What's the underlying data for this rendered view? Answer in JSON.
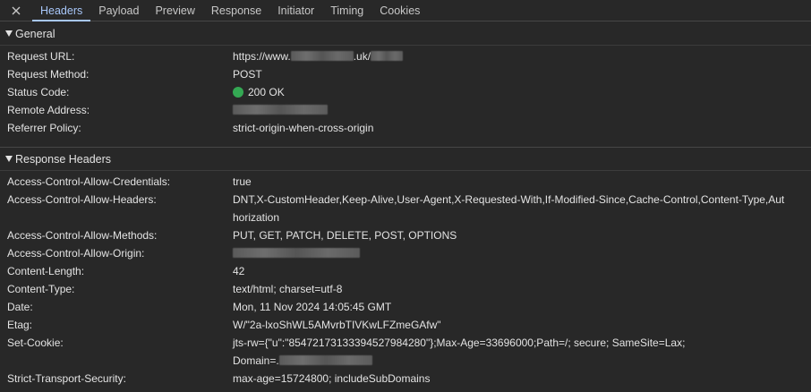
{
  "tabs": [
    {
      "label": "Headers",
      "active": true
    },
    {
      "label": "Payload"
    },
    {
      "label": "Preview"
    },
    {
      "label": "Response"
    },
    {
      "label": "Initiator"
    },
    {
      "label": "Timing"
    },
    {
      "label": "Cookies"
    }
  ],
  "general": {
    "title": "General",
    "rows": {
      "request_url": {
        "key": "Request URL:",
        "value_prefix": "https://www.",
        "value_mid": ".uk/"
      },
      "request_method": {
        "key": "Request Method:",
        "value": "POST"
      },
      "status_code": {
        "key": "Status Code:",
        "value": "200 OK",
        "status_color": "#34a853"
      },
      "remote_address": {
        "key": "Remote Address:"
      },
      "referrer_policy": {
        "key": "Referrer Policy:",
        "value": "strict-origin-when-cross-origin"
      }
    }
  },
  "response_headers": {
    "title": "Response Headers",
    "rows": {
      "acac": {
        "key": "Access-Control-Allow-Credentials:",
        "value": "true"
      },
      "acah": {
        "key": "Access-Control-Allow-Headers:",
        "value": "DNT,X-CustomHeader,Keep-Alive,User-Agent,X-Requested-With,If-Modified-Since,Cache-Control,Content-Type,Authorization"
      },
      "acam": {
        "key": "Access-Control-Allow-Methods:",
        "value": "PUT, GET, PATCH, DELETE, POST, OPTIONS"
      },
      "acao": {
        "key": "Access-Control-Allow-Origin:"
      },
      "content_length": {
        "key": "Content-Length:",
        "value": "42"
      },
      "content_type": {
        "key": "Content-Type:",
        "value": "text/html; charset=utf-8"
      },
      "date": {
        "key": "Date:",
        "value": "Mon, 11 Nov 2024 14:05:45 GMT"
      },
      "etag": {
        "key": "Etag:",
        "value": "W/\"2a-lxoShWL5AMvrbTIVKwLFZmeGAfw\""
      },
      "set_cookie": {
        "key": "Set-Cookie:",
        "value_line1": "jts-rw={\"u\":\"8547217313339452798428​0\"};Max-Age=33696000;Path=/; secure; SameSite=Lax;",
        "value_line2_prefix": "Domain=."
      },
      "sts": {
        "key": "Strict-Transport-Security:",
        "value": "max-age=15724800; includeSubDomains"
      }
    }
  },
  "colors": {
    "background": "#282828",
    "active_tab": "#a8c7fa",
    "text": "#e3e3e3",
    "status_ok": "#34a853"
  },
  "icons": {
    "close": "close-icon",
    "expand": "triangle-down-icon"
  }
}
